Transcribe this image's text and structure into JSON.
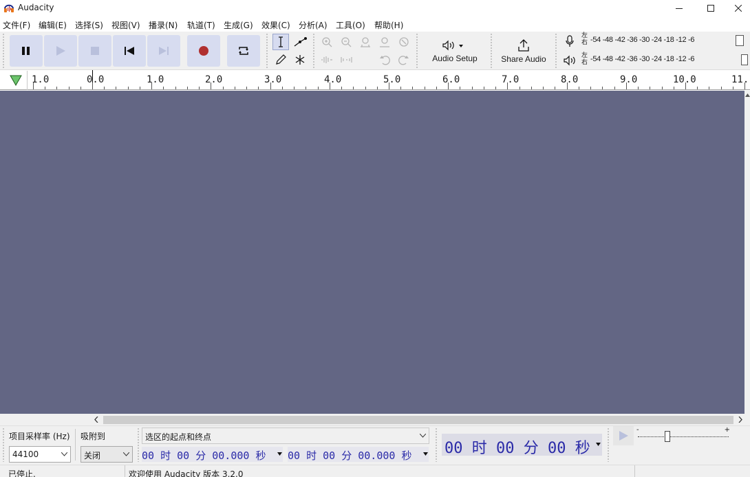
{
  "window": {
    "title": "Audacity"
  },
  "menu": [
    "文件(F)",
    "编辑(E)",
    "选择(S)",
    "视图(V)",
    "播录(N)",
    "轨道(T)",
    "生成(G)",
    "效果(C)",
    "分析(A)",
    "工具(O)",
    "帮助(H)"
  ],
  "toolbar": {
    "audio_setup_label": "Audio Setup",
    "share_audio_label": "Share Audio"
  },
  "meters": {
    "record_scale": "-54 -48 -42 -36 -30 -24 -18 -12 -6",
    "play_scale": "-54 -48 -42 -36 -30 -24 -18 -12 -6",
    "left_channel": "左",
    "right_channel": "右"
  },
  "ruler": {
    "labels": [
      "1.0",
      "0.0",
      "1.0",
      "2.0",
      "3.0",
      "4.0",
      "5.0",
      "6.0",
      "7.0",
      "8.0",
      "9.0",
      "10.0",
      "11."
    ]
  },
  "bottom": {
    "project_rate_label": "项目采样率 (Hz)",
    "project_rate_value": "44100",
    "snap_label": "吸附到",
    "snap_value": "关闭",
    "selection_mode": "选区的起点和终点",
    "sel_start": "00 时 00 分 00.000 秒",
    "sel_end": "00 时 00 分 00.000 秒",
    "audio_position": "00 时 00 分 00 秒"
  },
  "status": {
    "state": "已停止.",
    "message": "欢迎使用 Audacity 版本 3.2.0"
  },
  "colors": {
    "track_bg": "#636684",
    "button_bg": "#d7dcf0",
    "record_red": "#b03030",
    "time_blue": "#2a2aa8"
  }
}
